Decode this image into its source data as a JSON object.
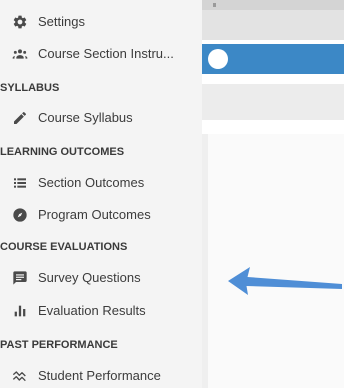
{
  "sidebar": {
    "top_items": [
      {
        "label": "Settings",
        "icon": "gear-icon"
      },
      {
        "label": "Course Section Instru...",
        "icon": "people-icon"
      }
    ],
    "sections": [
      {
        "header": "SYLLABUS",
        "items": [
          {
            "label": "Course Syllabus",
            "icon": "pencil-icon"
          }
        ]
      },
      {
        "header": "LEARNING OUTCOMES",
        "items": [
          {
            "label": "Section Outcomes",
            "icon": "list-icon"
          },
          {
            "label": "Program Outcomes",
            "icon": "compass-icon"
          }
        ]
      },
      {
        "header": "COURSE EVALUATIONS",
        "items": [
          {
            "label": "Survey Questions",
            "icon": "message-icon"
          },
          {
            "label": "Evaluation Results",
            "icon": "bar-chart-icon"
          }
        ]
      },
      {
        "header": "PAST PERFORMANCE",
        "items": [
          {
            "label": "Student Performance",
            "icon": "trend-icon"
          }
        ]
      }
    ]
  },
  "colors": {
    "sidebar_bg": "#f4f4f4",
    "icon_color": "#4a4a4a",
    "accent_blue": "#3c88c6",
    "arrow_blue": "#4f8ed6"
  }
}
